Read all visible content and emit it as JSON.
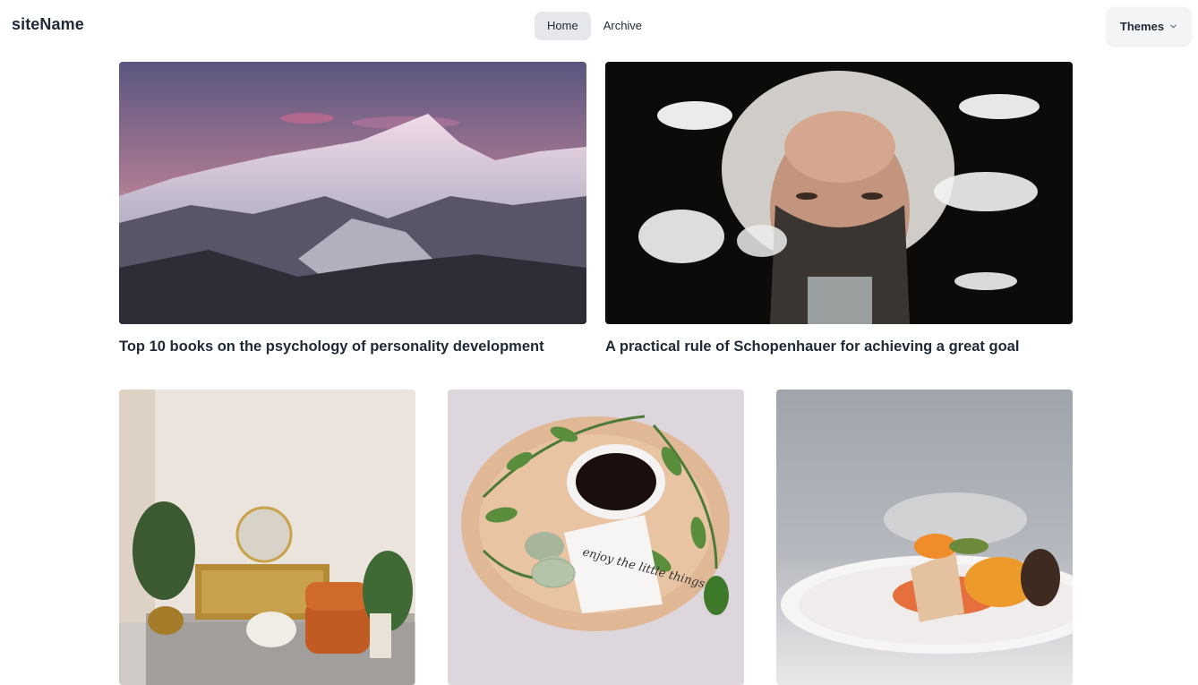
{
  "header": {
    "site_name": "siteName",
    "nav": [
      {
        "label": "Home",
        "active": true
      },
      {
        "label": "Archive",
        "active": false
      }
    ],
    "themes_label": "Themes"
  },
  "posts": [
    {
      "title": "Top 10 books on the psychology of personality development",
      "image": "snowy mountain range at dusk"
    },
    {
      "title": "A practical rule of Schopenhauer for achieving a great goal",
      "image": "elderly man with white hair and clouds"
    },
    {
      "title": "",
      "image": "living room with orange armchair and plants"
    },
    {
      "title": "",
      "image": "coffee cup on wooden board with leaves and note"
    },
    {
      "title": "",
      "image": "plated dish with salmon and orange garnish"
    }
  ],
  "note_text": "enjoy the little things",
  "colors": {
    "nav_active_bg": "#e5e7eb",
    "text": "#1f2937",
    "themes_bg": "#f3f4f6"
  },
  "icons": {
    "themes_dropdown": "chevron-down-icon"
  }
}
